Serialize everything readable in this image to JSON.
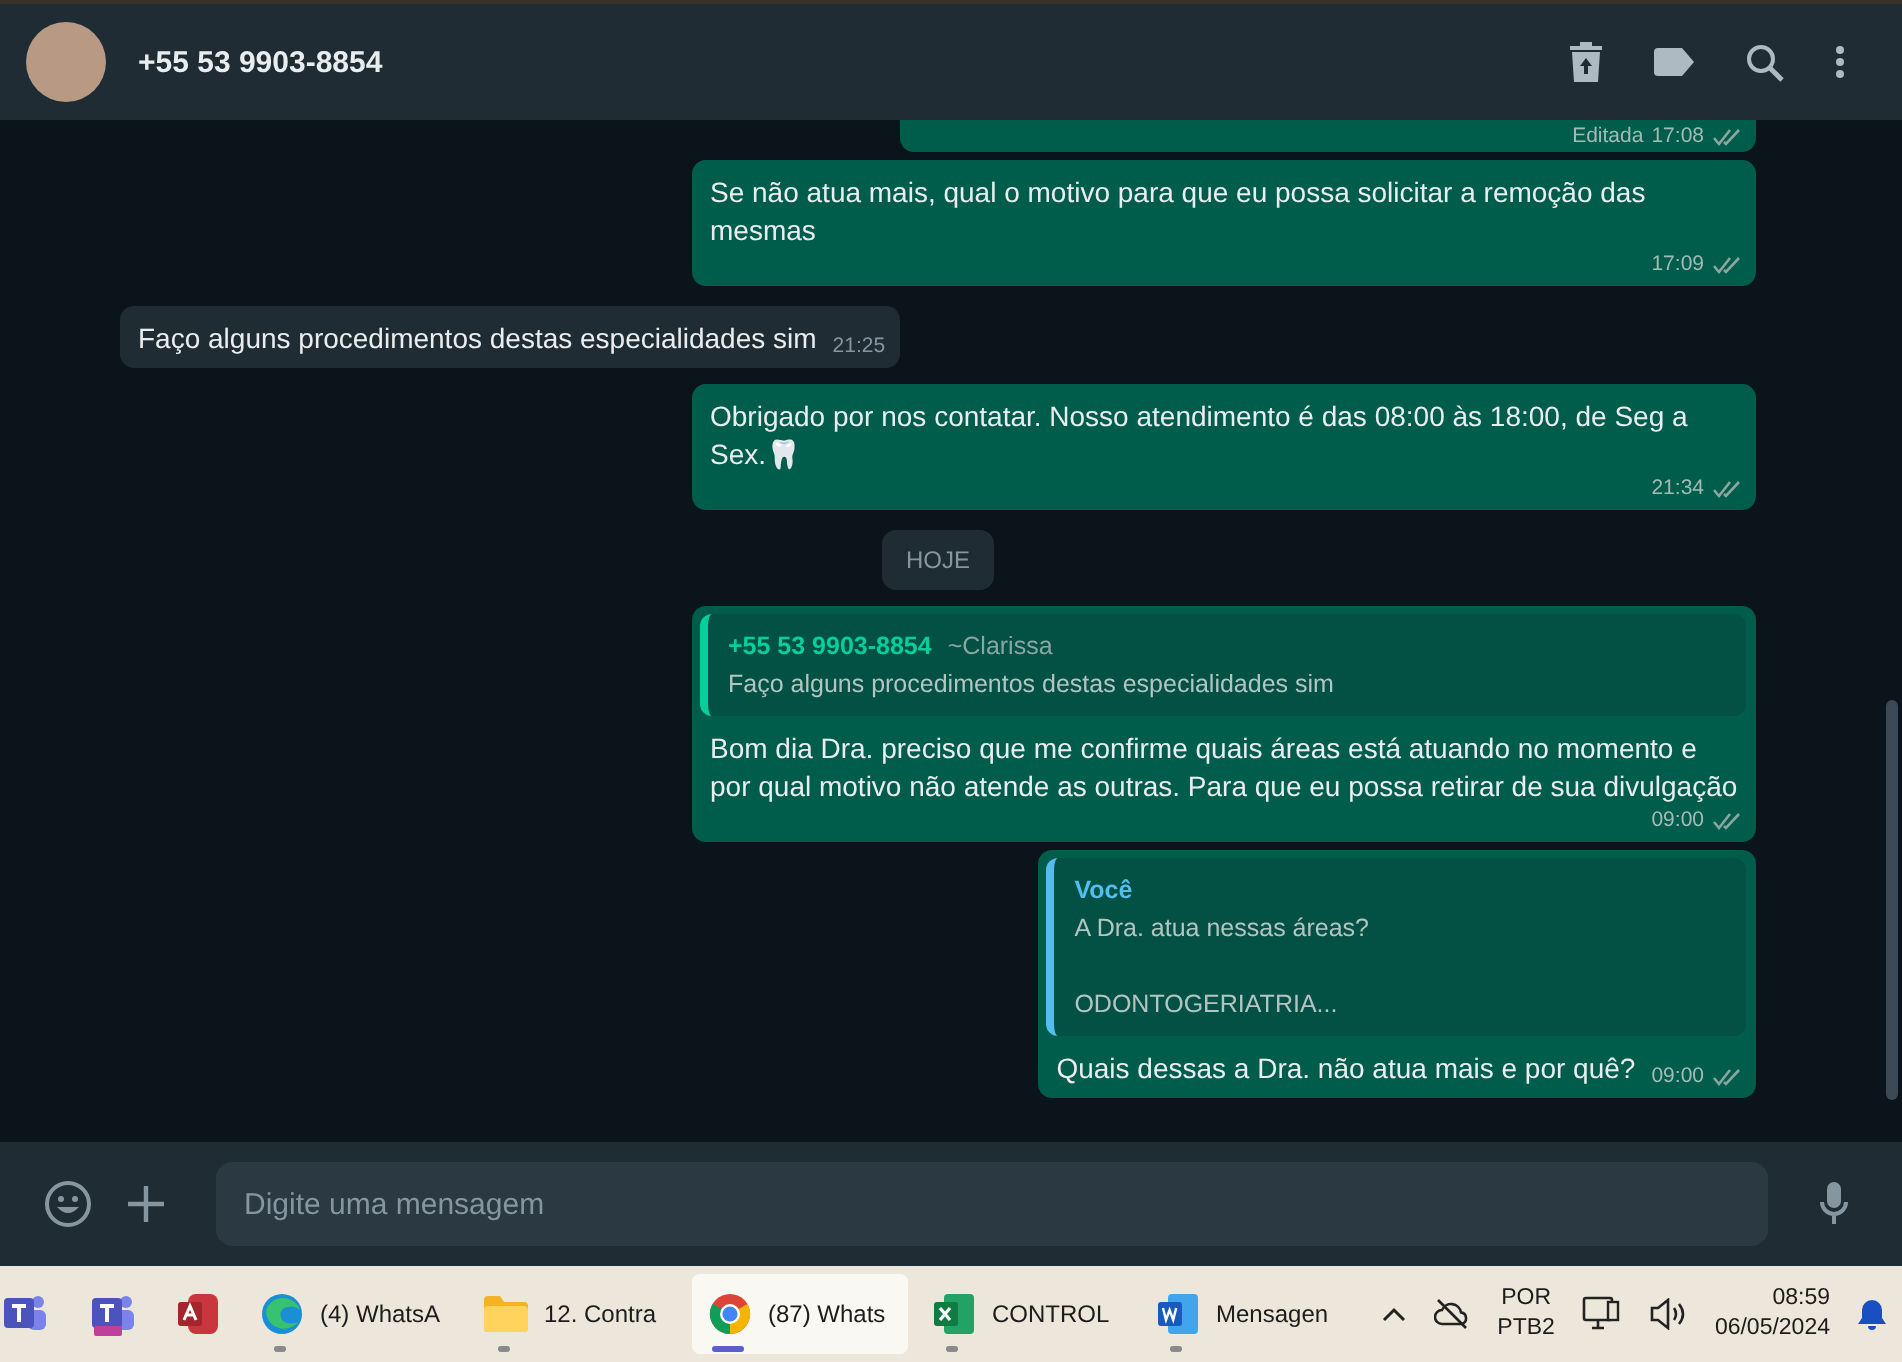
{
  "header": {
    "title": "+55 53 9903-8854"
  },
  "messages": [
    {
      "kind": "out",
      "edited": "Editada",
      "time": "17:08"
    },
    {
      "kind": "out",
      "text": "Se não atua mais, qual o motivo para que eu possa solicitar a remoção das mesmas",
      "time": "17:09"
    },
    {
      "kind": "in",
      "text": "Faço alguns procedimentos destas especialidades sim",
      "time": "21:25"
    },
    {
      "kind": "out",
      "text": "Obrigado por nos contatar. Nosso atendimento é das 08:00 às 18:00, de Seg a Sex.🦷",
      "time": "21:34"
    },
    {
      "kind": "date",
      "text": "HOJE"
    },
    {
      "kind": "out",
      "quote": {
        "author": "+55 53 9903-8854",
        "alias": "~Clarissa",
        "text": "Faço alguns procedimentos destas especialidades sim",
        "color": "#06cf9c"
      },
      "text": "Bom dia Dra. preciso que me confirme quais áreas está atuando no momento e por qual motivo não atende as outras. Para que eu possa retirar de sua divulgação",
      "time": "09:00"
    },
    {
      "kind": "out",
      "quote": {
        "author": "Você",
        "text": "A Dra. atua nessas áreas?\n\nODONTOGERIATRIA...",
        "color": "#53bdeb"
      },
      "text": "Quais dessas a Dra. não atua mais e por quê?",
      "time": "09:00"
    }
  ],
  "composer": {
    "placeholder": "Digite uma mensagem"
  },
  "taskbar": {
    "apps": [
      {
        "kind": "teams",
        "running": false,
        "selected": false
      },
      {
        "kind": "teamsnew",
        "running": false,
        "selected": false
      },
      {
        "kind": "access",
        "running": false,
        "selected": false
      },
      {
        "kind": "edge",
        "label": "(4) WhatsA",
        "running": true,
        "selected": false
      },
      {
        "kind": "folder",
        "label": "12. Contra",
        "running": true,
        "selected": false
      },
      {
        "kind": "chrome",
        "label": "(87) Whats",
        "running": true,
        "selected": true
      },
      {
        "kind": "excel",
        "label": "CONTROL",
        "running": true,
        "selected": false
      },
      {
        "kind": "word",
        "label": "Mensagen",
        "running": true,
        "selected": false
      }
    ],
    "language": [
      "POR",
      "PTB2"
    ],
    "time": "08:59",
    "date": "06/05/2024"
  }
}
